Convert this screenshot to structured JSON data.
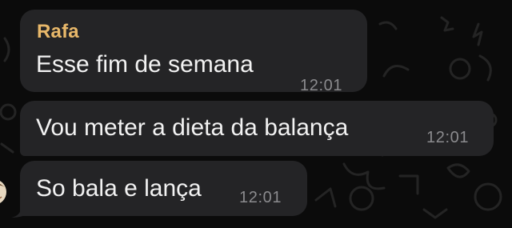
{
  "chat": {
    "sender": "Rafa",
    "sender_color": "#e8b86a",
    "bubble_color": "#242426",
    "messages": [
      {
        "text": "Esse fim de semana",
        "time": "12:01"
      },
      {
        "text": "Vou meter a dieta da balança",
        "time": "12:01"
      },
      {
        "text": "So bala e lança",
        "time": "12:01"
      }
    ]
  },
  "icons": {
    "avatar": "sender-avatar",
    "background": "chat-doodle-wallpaper"
  }
}
